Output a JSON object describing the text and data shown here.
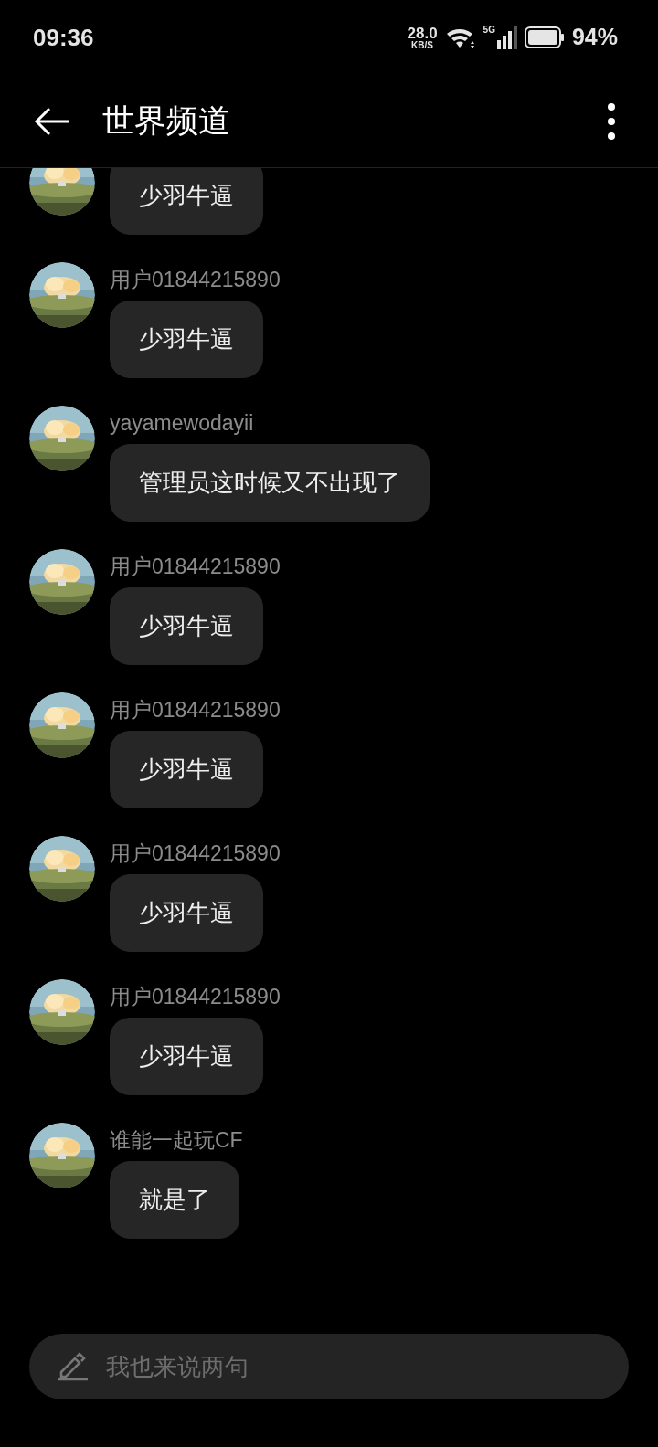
{
  "status_bar": {
    "time": "09:36",
    "net_speed": "28.0",
    "net_unit": "KB/S",
    "network": "5G",
    "battery": "94%"
  },
  "header": {
    "title": "世界频道"
  },
  "messages": [
    {
      "kind": "picture",
      "text": "少羽牛逼"
    },
    {
      "kind": "picture",
      "user": "用户01844215890",
      "text": "少羽牛逼"
    },
    {
      "kind": "picture",
      "user": "yayamewodayii",
      "text": "管理员这时候又不出现了"
    },
    {
      "kind": "picture",
      "user": "用户01844215890",
      "text": "少羽牛逼"
    },
    {
      "kind": "picture",
      "user": "用户01844215890",
      "text": "少羽牛逼"
    },
    {
      "kind": "picture",
      "user": "用户01844215890",
      "text": "少羽牛逼"
    },
    {
      "kind": "picture",
      "user": "用户01844215890",
      "text": "少羽牛逼"
    },
    {
      "kind": "picture",
      "user": "谁能一起玩CF",
      "text": "就是了"
    }
  ],
  "composer": {
    "placeholder": "我也来说两句"
  }
}
